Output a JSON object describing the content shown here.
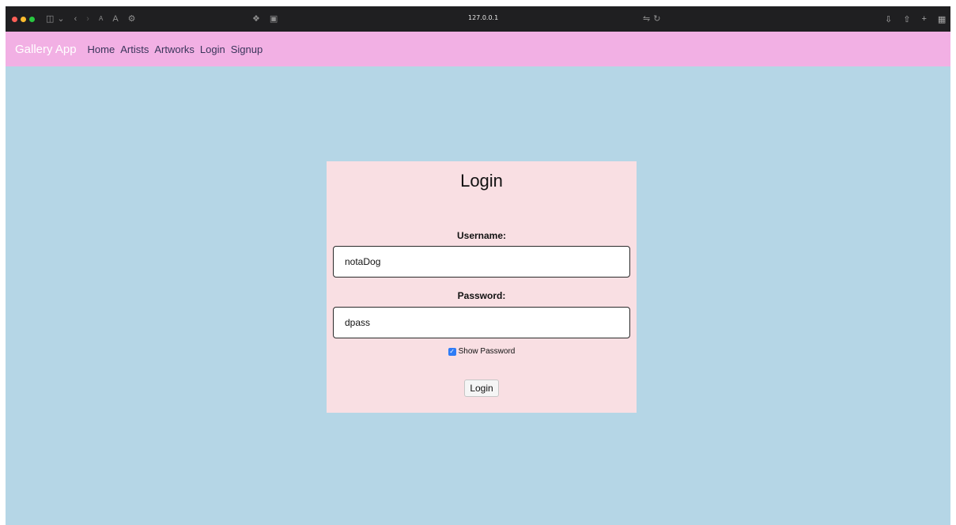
{
  "browser": {
    "url": "127.0.0.1",
    "icons": {
      "traffic_lights": [
        "#ff5f57",
        "#febc2e",
        "#28c840"
      ],
      "left": [
        "sidebar-icon",
        "chevron-down-icon",
        "back-icon",
        "forward-icon",
        "text-small-icon",
        "text-large-icon",
        "settings-icon"
      ],
      "center": [
        "extension-icon",
        "notion-icon"
      ],
      "url_right": [
        "translate-icon",
        "reload-icon"
      ],
      "right": [
        "download-icon",
        "share-icon",
        "new-tab-icon",
        "tab-overview-icon"
      ]
    }
  },
  "navbar": {
    "brand": "Gallery App",
    "links": [
      "Home",
      "Artists",
      "Artworks",
      "Login",
      "Signup"
    ],
    "background": "#f2b0e4"
  },
  "login": {
    "title": "Login",
    "username_label": "Username:",
    "username_value": "notaDog",
    "password_label": "Password:",
    "password_value": "dpass",
    "show_password_label": "Show Password",
    "show_password_checked": true,
    "submit_label": "Login",
    "card_background": "#f9dfe3"
  },
  "page_background": "#b5d6e6"
}
